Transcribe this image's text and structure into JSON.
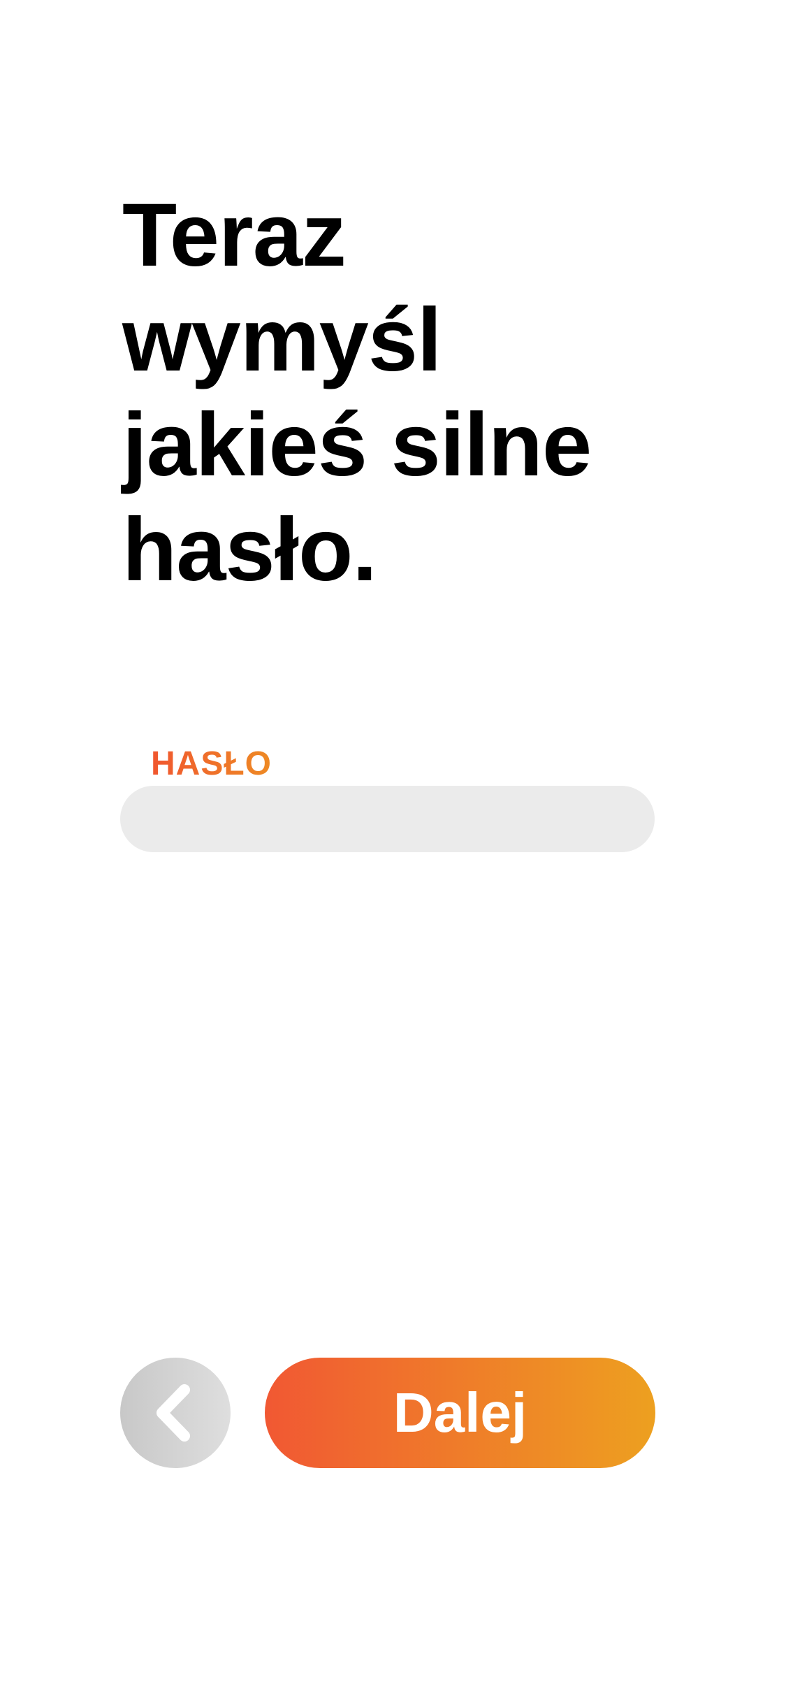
{
  "headline": {
    "text": "Teraz wymyśl jakieś silne hasło."
  },
  "password_field": {
    "label": "HASŁO",
    "value": "",
    "placeholder": ""
  },
  "actions": {
    "back_icon": "chevron-left-icon",
    "next_label": "Dalej"
  },
  "colors": {
    "label_gradient_start": "#f0562f",
    "label_gradient_end": "#ee8a24",
    "input_background": "#ebebeb",
    "back_button_gradient_start": "#c8c8c8",
    "back_button_gradient_end": "#dedede",
    "next_gradient_start": "#f15833",
    "next_gradient_end": "#eda020"
  }
}
